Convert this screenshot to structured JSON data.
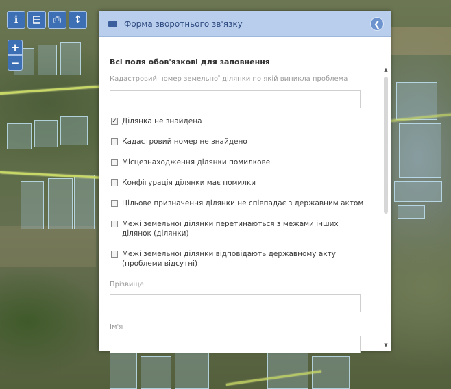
{
  "panel": {
    "title": "Форма зворотнього зв'язку",
    "close_icon": "close-icon",
    "required_heading": "Всі поля обов'язкові для заповнення",
    "cadastral_label": "Кадастровий номер земельної ділянки по якій виникла проблема",
    "cadastral_value": "",
    "checkboxes": [
      {
        "label": "Ділянка не знайдена",
        "checked": true
      },
      {
        "label": "Кадастровий номер не знайдено",
        "checked": false
      },
      {
        "label": "Місцезнаходження ділянки помилкове",
        "checked": false
      },
      {
        "label": "Конфігурація ділянки має помилки",
        "checked": false
      },
      {
        "label": "Цільове призначення ділянки не співпадає з державним актом",
        "checked": false
      },
      {
        "label": "Межі земельної ділянки перетинаються з межами інших ділянок (ділянки)",
        "checked": false
      },
      {
        "label": "Межі земельної ділянки відповідають державному акту (проблеми відсутні)",
        "checked": false
      }
    ],
    "surname_label": "Прізвище",
    "surname_value": "",
    "name_label": "Ім'я",
    "name_value": ""
  },
  "toolbar": {
    "icons": [
      "info-icon",
      "layers-icon",
      "print-icon",
      "measure-icon"
    ],
    "zoom_in": "+",
    "zoom_out": "−"
  },
  "colors": {
    "header_bg": "#b9cdec",
    "toolbar_blue": "#3d6fb4",
    "parcel_outline": "#c8ebff",
    "road_yellow": "#c8d866"
  }
}
